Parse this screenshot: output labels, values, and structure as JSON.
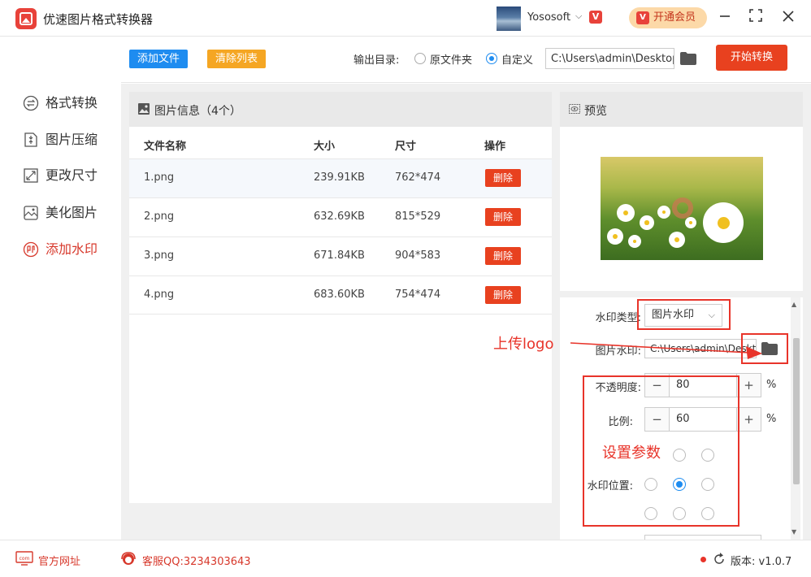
{
  "titlebar": {
    "app_title": "优速图片格式转换器",
    "user_name": "Yososoft",
    "brand_badge": "V",
    "vip_label": "开通会员"
  },
  "sidebar": {
    "items": [
      {
        "label": "格式转换",
        "icon": "format-convert-icon",
        "active": false
      },
      {
        "label": "图片压缩",
        "icon": "compress-icon",
        "active": false
      },
      {
        "label": "更改尺寸",
        "icon": "resize-icon",
        "active": false
      },
      {
        "label": "美化图片",
        "icon": "beautify-icon",
        "active": false
      },
      {
        "label": "添加水印",
        "icon": "watermark-icon",
        "active": true
      }
    ]
  },
  "toolbar": {
    "add_files": "添加文件",
    "clear_list": "清除列表",
    "output_label": "输出目录:",
    "option_original": "原文件夹",
    "option_custom": "自定义",
    "output_path": "C:\\Users\\admin\\Desktop",
    "start_label": "开始转换"
  },
  "file_panel": {
    "title": "图片信息（4个）",
    "columns": [
      "文件名称",
      "大小",
      "尺寸",
      "操作"
    ],
    "delete_label": "删除",
    "rows": [
      {
        "name": "1.png",
        "size": "239.91KB",
        "dims": "762*474"
      },
      {
        "name": "2.png",
        "size": "632.69KB",
        "dims": "815*529"
      },
      {
        "name": "3.png",
        "size": "671.84KB",
        "dims": "904*583"
      },
      {
        "name": "4.png",
        "size": "683.60KB",
        "dims": "754*474"
      }
    ]
  },
  "preview": {
    "title": "预览"
  },
  "settings": {
    "wm_type_label": "水印类型:",
    "wm_type_value": "图片水印",
    "wm_image_label": "图片水印:",
    "wm_image_path": "C:\\Users\\admin\\Desktop",
    "opacity_label": "不透明度:",
    "opacity_value": "80",
    "scale_label": "比例:",
    "scale_value": "60",
    "percent": "%",
    "position_label": "水印位置:",
    "position_selected": "center"
  },
  "annotations": {
    "upload_logo": "上传logo",
    "set_params": "设置参数",
    "color": "#e8342a"
  },
  "footer": {
    "website": "官方网址",
    "support": "客服QQ:3234303643",
    "version": "版本: v1.0.7"
  },
  "colors": {
    "accent_red": "#e8411f",
    "accent_blue": "#1e8cf0",
    "accent_orange": "#f5a623"
  }
}
